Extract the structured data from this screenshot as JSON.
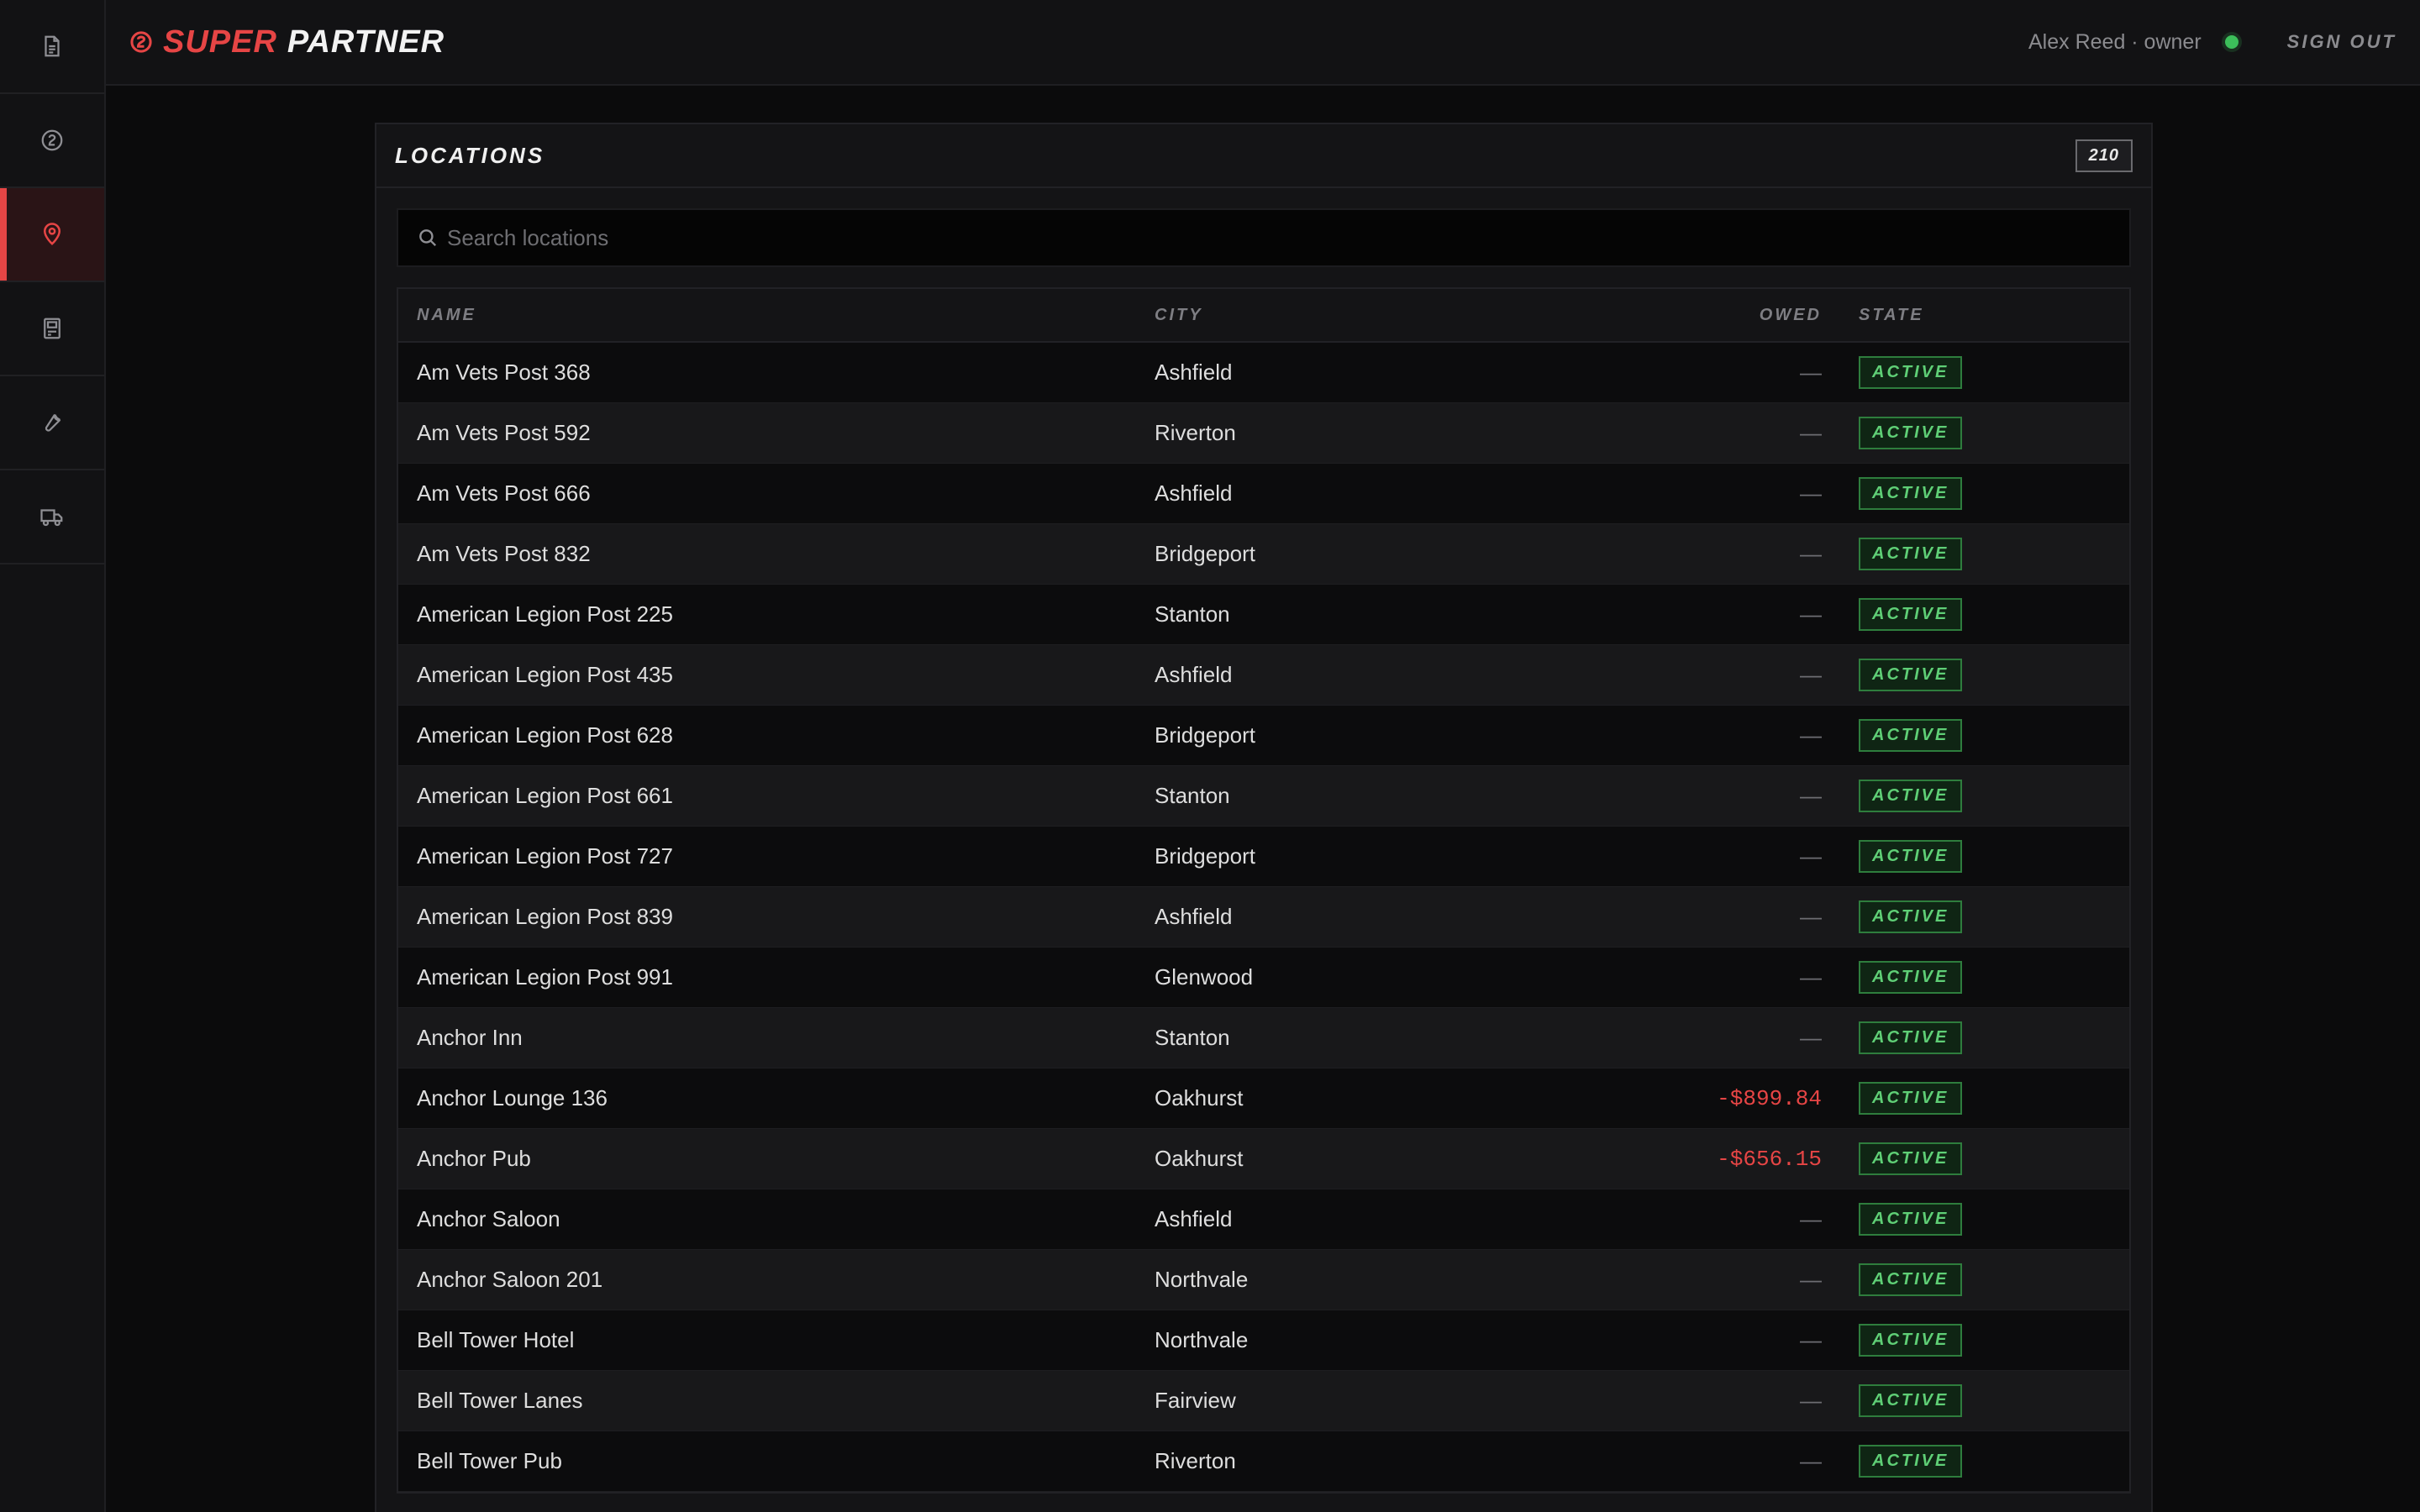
{
  "brand": {
    "super": "SUPER",
    "partner": "PARTNER"
  },
  "user": {
    "label": "Alex Reed · owner",
    "signout": "SIGN OUT"
  },
  "sidebar": {
    "items": [
      {
        "icon": "document-icon",
        "active": false
      },
      {
        "icon": "coin-icon",
        "active": false
      },
      {
        "icon": "map-pin-icon",
        "active": true
      },
      {
        "icon": "machine-icon",
        "active": false
      },
      {
        "icon": "wrench-icon",
        "active": false
      },
      {
        "icon": "truck-icon",
        "active": false
      }
    ]
  },
  "colors": {
    "accent": "#e64545",
    "status_online": "#3cbf5a",
    "state_active": "#5fcf76",
    "owed_negative": "#e64545"
  },
  "locations": {
    "title": "LOCATIONS",
    "count": "210",
    "search_placeholder": "Search locations",
    "columns": {
      "name": "NAME",
      "city": "CITY",
      "owed": "OWED",
      "state": "STATE"
    },
    "rows": [
      {
        "name": "Am Vets Post 368",
        "city": "Ashfield",
        "owed": "—",
        "state": "ACTIVE"
      },
      {
        "name": "Am Vets Post 592",
        "city": "Riverton",
        "owed": "—",
        "state": "ACTIVE"
      },
      {
        "name": "Am Vets Post 666",
        "city": "Ashfield",
        "owed": "—",
        "state": "ACTIVE"
      },
      {
        "name": "Am Vets Post 832",
        "city": "Bridgeport",
        "owed": "—",
        "state": "ACTIVE"
      },
      {
        "name": "American Legion Post 225",
        "city": "Stanton",
        "owed": "—",
        "state": "ACTIVE"
      },
      {
        "name": "American Legion Post 435",
        "city": "Ashfield",
        "owed": "—",
        "state": "ACTIVE"
      },
      {
        "name": "American Legion Post 628",
        "city": "Bridgeport",
        "owed": "—",
        "state": "ACTIVE"
      },
      {
        "name": "American Legion Post 661",
        "city": "Stanton",
        "owed": "—",
        "state": "ACTIVE"
      },
      {
        "name": "American Legion Post 727",
        "city": "Bridgeport",
        "owed": "—",
        "state": "ACTIVE"
      },
      {
        "name": "American Legion Post 839",
        "city": "Ashfield",
        "owed": "—",
        "state": "ACTIVE"
      },
      {
        "name": "American Legion Post 991",
        "city": "Glenwood",
        "owed": "—",
        "state": "ACTIVE"
      },
      {
        "name": "Anchor Inn",
        "city": "Stanton",
        "owed": "—",
        "state": "ACTIVE"
      },
      {
        "name": "Anchor Lounge 136",
        "city": "Oakhurst",
        "owed": "-$899.84",
        "state": "ACTIVE"
      },
      {
        "name": "Anchor Pub",
        "city": "Oakhurst",
        "owed": "-$656.15",
        "state": "ACTIVE"
      },
      {
        "name": "Anchor Saloon",
        "city": "Ashfield",
        "owed": "—",
        "state": "ACTIVE"
      },
      {
        "name": "Anchor Saloon 201",
        "city": "Northvale",
        "owed": "—",
        "state": "ACTIVE"
      },
      {
        "name": "Bell Tower Hotel",
        "city": "Northvale",
        "owed": "—",
        "state": "ACTIVE"
      },
      {
        "name": "Bell Tower Lanes",
        "city": "Fairview",
        "owed": "—",
        "state": "ACTIVE"
      },
      {
        "name": "Bell Tower Pub",
        "city": "Riverton",
        "owed": "—",
        "state": "ACTIVE"
      }
    ]
  }
}
